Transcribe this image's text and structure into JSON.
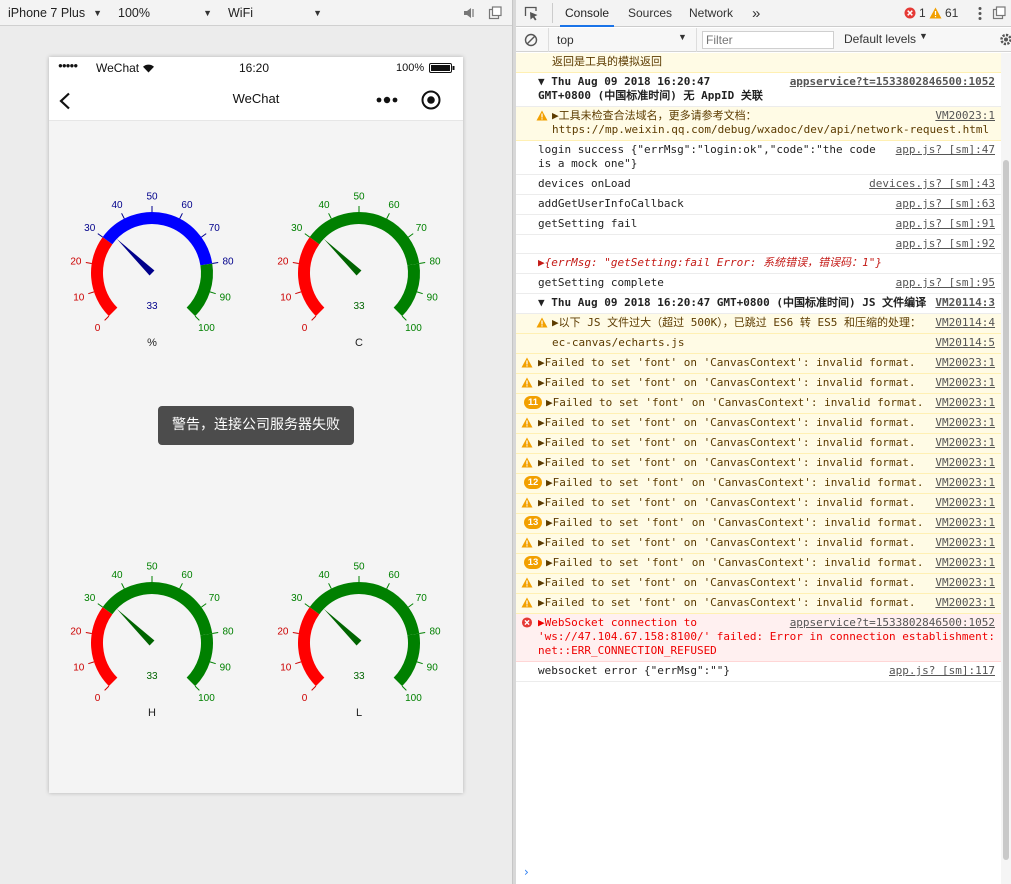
{
  "simulator": {
    "device": "iPhone 7 Plus",
    "zoom": "100%",
    "network": "WiFi"
  },
  "phone": {
    "signal": "●●●●●",
    "carrier": "WeChat",
    "time": "16:20",
    "battery": "100%",
    "nav_title": "WeChat",
    "toast": "警告，连接公司服务器失败"
  },
  "gauges": [
    {
      "label": "%",
      "value": 33,
      "active_color": "#0000ff",
      "pointer_color": "#00008b"
    },
    {
      "label": "C",
      "value": 33,
      "active_color": "#008000",
      "pointer_color": "#006400"
    },
    {
      "label": "H",
      "value": 33,
      "active_color": "#008000",
      "pointer_color": "#006400"
    },
    {
      "label": "L",
      "value": 33,
      "active_color": "#008000",
      "pointer_color": "#006400"
    }
  ],
  "gauge_ticks": [
    "0",
    "10",
    "20",
    "30",
    "40",
    "50",
    "60",
    "70",
    "80",
    "90",
    "100"
  ],
  "colors": {
    "gauge_red": "#ff0000",
    "gauge_green": "#008000",
    "gauge_blue": "#0000ff",
    "tick_red": "#cc0000",
    "tick_green": "#008000",
    "tick_blue": "#00008b",
    "accent": "#1a73e8"
  },
  "devtools": {
    "tabs": [
      "Console",
      "Sources",
      "Network"
    ],
    "more": "»",
    "error_count": "1",
    "warning_count": "61",
    "context": "top",
    "filter_placeholder": "Filter",
    "levels": "Default levels",
    "prompt": "›"
  },
  "log": [
    {
      "kind": "warn-plain",
      "text": "返回是工具的模拟返回",
      "src": ""
    },
    {
      "kind": "group",
      "text": "▼ Thu Aug 09 2018 16:20:47\nGMT+0800 (中国标准时间) 无 AppID 关联",
      "src": "appservice?t=1533802846500:1052"
    },
    {
      "kind": "warn-indent",
      "text": "▶工具未检查合法域名，更多请参考文档：https://mp.weixin.qq.com/debug/wxadoc/dev/api/network-request.html",
      "src": "VM20023:1"
    },
    {
      "kind": "info",
      "text": "login success {\"errMsg\":\"login:ok\",\"code\":\"the code is a mock one\"}",
      "src": "app.js? [sm]:47"
    },
    {
      "kind": "info",
      "text": "devices onLoad",
      "src": "devices.js? [sm]:43"
    },
    {
      "kind": "info",
      "text": "addGetUserInfoCallback",
      "src": "app.js? [sm]:63"
    },
    {
      "kind": "info",
      "text": "getSetting fail",
      "src": "app.js? [sm]:91"
    },
    {
      "kind": "info",
      "text": "",
      "src": "app.js? [sm]:92"
    },
    {
      "kind": "obj",
      "text": "▶{errMsg: \"getSetting:fail Error: 系统错误，错误码：1\"}",
      "src": ""
    },
    {
      "kind": "info",
      "text": "getSetting complete",
      "src": "app.js? [sm]:95"
    },
    {
      "kind": "group",
      "text": "▼ Thu Aug 09 2018 16:20:47 GMT+0800 (中国标准时间) JS 文件编译",
      "src": "VM20114:3"
    },
    {
      "kind": "warn-indent",
      "text": "▶以下 JS 文件过大（超过 500K），已跳过 ES6 转 ES5 和压缩的处理：",
      "src": "VM20114:4"
    },
    {
      "kind": "warn-indent-plain",
      "text": "ec-canvas/echarts.js",
      "src": "VM20114:5"
    },
    {
      "kind": "warn",
      "text": "▶Failed to set 'font' on 'CanvasContext': invalid format.",
      "src": "VM20023:1"
    },
    {
      "kind": "warn",
      "text": "▶Failed to set 'font' on 'CanvasContext': invalid format.",
      "src": "VM20023:1"
    },
    {
      "kind": "warn-badge",
      "badge": "11",
      "text": "▶Failed to set 'font' on 'CanvasContext': invalid format.",
      "src": "VM20023:1"
    },
    {
      "kind": "warn",
      "text": "▶Failed to set 'font' on 'CanvasContext': invalid format.",
      "src": "VM20023:1"
    },
    {
      "kind": "warn",
      "text": "▶Failed to set 'font' on 'CanvasContext': invalid format.",
      "src": "VM20023:1"
    },
    {
      "kind": "warn",
      "text": "▶Failed to set 'font' on 'CanvasContext': invalid format.",
      "src": "VM20023:1"
    },
    {
      "kind": "warn-badge",
      "badge": "12",
      "text": "▶Failed to set 'font' on 'CanvasContext': invalid format.",
      "src": "VM20023:1"
    },
    {
      "kind": "warn",
      "text": "▶Failed to set 'font' on 'CanvasContext': invalid format.",
      "src": "VM20023:1"
    },
    {
      "kind": "warn-badge",
      "badge": "13",
      "text": "▶Failed to set 'font' on 'CanvasContext': invalid format.",
      "src": "VM20023:1"
    },
    {
      "kind": "warn",
      "text": "▶Failed to set 'font' on 'CanvasContext': invalid format.",
      "src": "VM20023:1"
    },
    {
      "kind": "warn-badge",
      "badge": "13",
      "text": "▶Failed to set 'font' on 'CanvasContext': invalid format.",
      "src": "VM20023:1"
    },
    {
      "kind": "warn",
      "text": "▶Failed to set 'font' on 'CanvasContext': invalid format.",
      "src": "VM20023:1"
    },
    {
      "kind": "warn",
      "text": "▶Failed to set 'font' on 'CanvasContext': invalid format.",
      "src": "VM20023:1"
    },
    {
      "kind": "error",
      "text": "▶WebSocket connection to 'ws://47.104.67.158:8100/' failed: Error in connection establishment: net::ERR_CONNECTION_REFUSED",
      "src": "appservice?t=1533802846500:1052"
    },
    {
      "kind": "info",
      "text": "websocket error {\"errMsg\":\"\"}",
      "src": "app.js? [sm]:117"
    }
  ]
}
